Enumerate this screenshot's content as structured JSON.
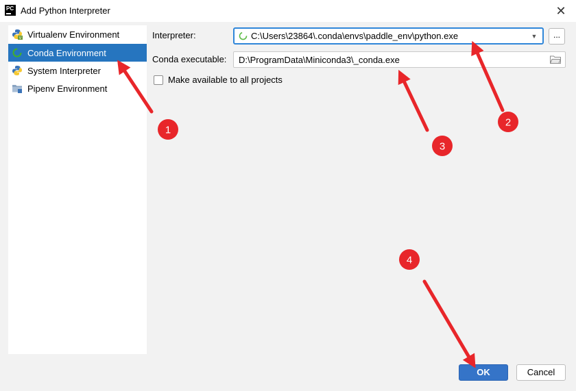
{
  "window": {
    "title": "Add Python Interpreter",
    "app_icon_text": "PC",
    "close_glyph": "✕"
  },
  "sidebar": {
    "items": [
      {
        "label": "Virtualenv Environment",
        "icon": "python-virtualenv-icon",
        "selected": false
      },
      {
        "label": "Conda Environment",
        "icon": "conda-spinner-icon",
        "selected": true
      },
      {
        "label": "System Interpreter",
        "icon": "python-icon",
        "selected": false
      },
      {
        "label": "Pipenv Environment",
        "icon": "pipenv-folder-icon",
        "selected": false
      }
    ]
  },
  "form": {
    "interpreter_label": "Interpreter:",
    "interpreter_value": "C:\\Users\\23864\\.conda\\envs\\paddle_env\\python.exe",
    "more_button_label": "...",
    "conda_label": "Conda executable:",
    "conda_value": "D:\\ProgramData\\Miniconda3\\_conda.exe",
    "make_available_label": "Make available to all projects",
    "make_available_checked": false
  },
  "buttons": {
    "ok_label": "OK",
    "cancel_label": "Cancel"
  },
  "annotations": {
    "color": "#e8262a",
    "badges": [
      "1",
      "2",
      "3",
      "4"
    ]
  }
}
